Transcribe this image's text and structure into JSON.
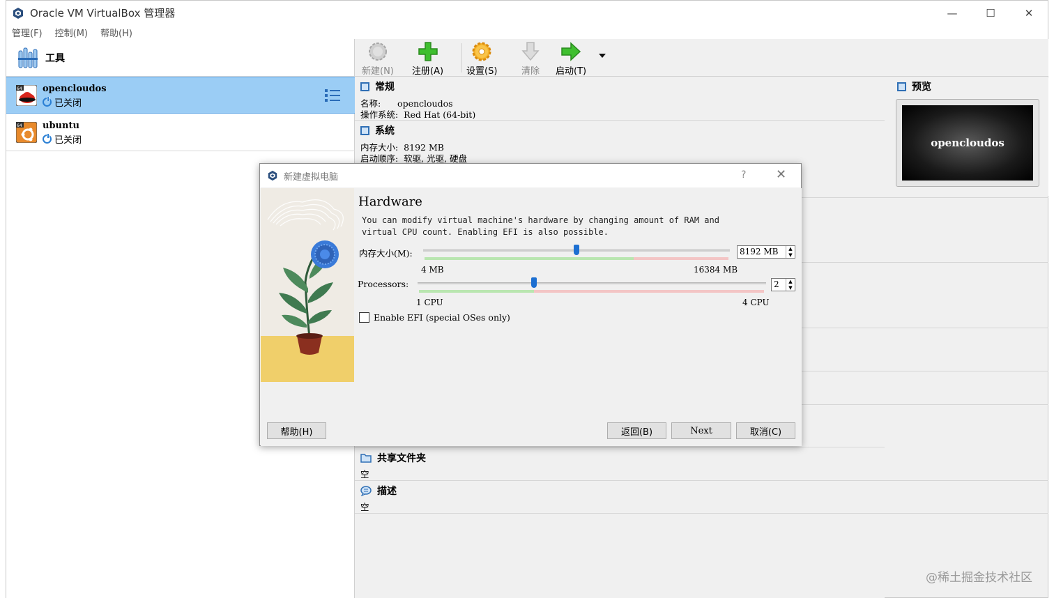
{
  "window": {
    "title": "Oracle VM VirtualBox 管理器",
    "minimize": "—",
    "maximize": "☐",
    "close": "✕"
  },
  "menubar": {
    "items": [
      "管理(F)",
      "控制(M)",
      "帮助(H)"
    ]
  },
  "tools": {
    "label": "工具"
  },
  "vms": [
    {
      "name": "opencloudos",
      "state": "已关闭",
      "selected": true
    },
    {
      "name": "ubuntu",
      "state": "已关闭",
      "selected": false
    }
  ],
  "toolbar": {
    "new_label": "新建(N)",
    "register_label": "注册(A)",
    "settings_label": "设置(S)",
    "discard_label": "清除",
    "start_label": "启动(T)"
  },
  "details": {
    "general_title": "常规",
    "general_name": "名称:      opencloudos",
    "general_os": "操作系统:  Red Hat (64-bit)",
    "system_title": "系统",
    "system_memory": "内存大小:  8192 MB",
    "system_boot": "启动顺序:  软驱, 光驱, 硬盘",
    "shared_title": "共享文件夹",
    "shared_value": "空",
    "description_title": "描述",
    "description_value": "空"
  },
  "preview": {
    "title": "预览",
    "screen_text": "opencloudos"
  },
  "dialog": {
    "title": "新建虚拟电脑",
    "help_glyph": "?",
    "close_glyph": "✕",
    "heading": "Hardware",
    "description_line1": "You can modify virtual machine's hardware by changing amount of RAM and",
    "description_line2": "virtual CPU count. Enabling EFI is also possible.",
    "memory": {
      "label": "内存大小(M):",
      "value": "8192 MB",
      "min_label": "4 MB",
      "max_label": "16384 MB",
      "fraction": 0.5
    },
    "processors": {
      "label": "Processors:",
      "value": "2",
      "min_label": "1 CPU",
      "max_label": "4 CPU",
      "fraction": 0.333
    },
    "efi_label": "Enable EFI (special OSes only)",
    "efi_checked": false,
    "help_button": "帮助(H)",
    "back_button": "返回(B)",
    "next_button": "Next",
    "cancel_button": "取消(C)"
  },
  "watermark": "@稀土掘金技术社区"
}
